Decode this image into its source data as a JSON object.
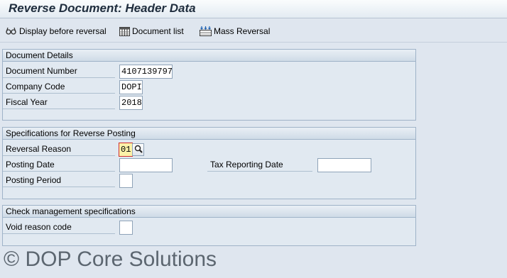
{
  "window": {
    "title": "Reverse Document: Header Data"
  },
  "toolbar": {
    "display_before_reversal": "Display before reversal",
    "document_list": "Document list",
    "mass_reversal": "Mass Reversal"
  },
  "document_details": {
    "title": "Document Details",
    "document_number_label": "Document Number",
    "document_number_value": "4107139797",
    "company_code_label": "Company Code",
    "company_code_value": "DOPI",
    "fiscal_year_label": "Fiscal Year",
    "fiscal_year_value": "2018"
  },
  "reverse_posting": {
    "title": "Specifications for Reverse Posting",
    "reversal_reason_label": "Reversal Reason",
    "reversal_reason_value": "01",
    "posting_date_label": "Posting Date",
    "posting_date_value": "",
    "tax_reporting_date_label": "Tax Reporting Date",
    "tax_reporting_date_value": "",
    "posting_period_label": "Posting Period",
    "posting_period_value": ""
  },
  "check_management": {
    "title": "Check management specifications",
    "void_reason_code_label": "Void reason code",
    "void_reason_code_value": ""
  },
  "watermark": "© DOP Core Solutions",
  "icons": {
    "display": "glasses-icon",
    "document_list": "list-icon",
    "mass_reversal": "mass-reversal-icon",
    "search": "search-icon"
  },
  "colors": {
    "background": "#dfe6ef",
    "required_field": "#fbf2a8",
    "required_border": "#d02e2e"
  }
}
